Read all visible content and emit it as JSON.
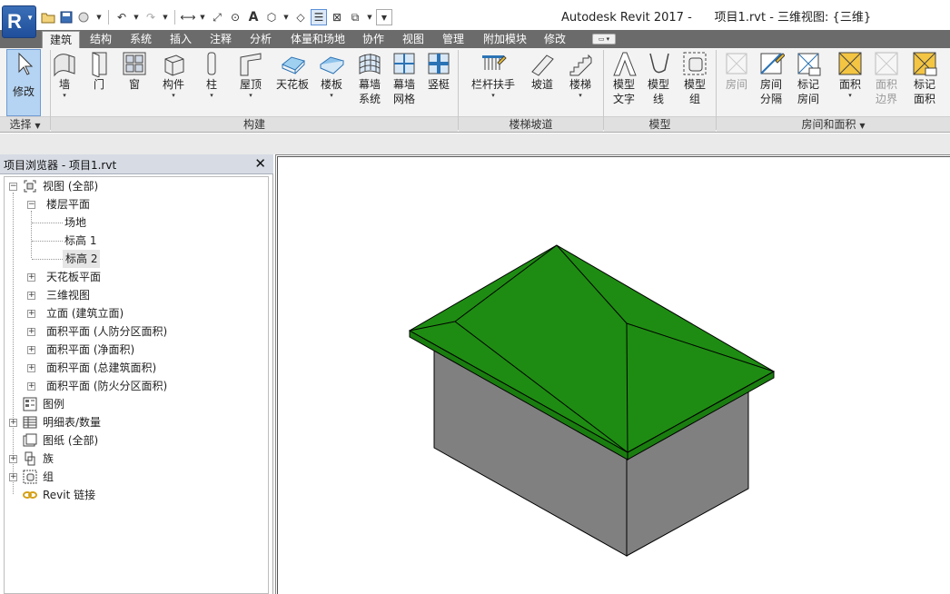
{
  "app": {
    "logo_letter": "R",
    "title_text": "Autodesk Revit 2017 -      项目1.rvt - 三维视图: {三维}"
  },
  "tabs": [
    "建筑",
    "结构",
    "系统",
    "插入",
    "注释",
    "分析",
    "体量和场地",
    "协作",
    "视图",
    "管理",
    "附加模块",
    "修改"
  ],
  "active_tab": "建筑",
  "ribbon": {
    "modify": "修改",
    "wall": "墙",
    "door": "门",
    "window": "窗",
    "component": "构件",
    "column": "柱",
    "roof": "屋顶",
    "ceiling": "天花板",
    "floor": "楼板",
    "curtain_system": [
      "幕墙",
      "系统"
    ],
    "curtain_grid": [
      "幕墙",
      "网格"
    ],
    "mullion": "竖梃",
    "railing": "栏杆扶手",
    "ramp": "坡道",
    "stair": "楼梯",
    "model_text": [
      "模型",
      "文字"
    ],
    "model_line": [
      "模型",
      "线"
    ],
    "model_group": [
      "模型",
      "组"
    ],
    "room": "房间",
    "room_separator": [
      "房间",
      "分隔"
    ],
    "tag_room": [
      "标记",
      "房间"
    ],
    "area": "面积",
    "area_boundary": [
      "面积",
      "边界"
    ],
    "tag_area": [
      "标记",
      "面积"
    ]
  },
  "panels": {
    "select": "选择",
    "build": "构建",
    "circulation": "楼梯坡道",
    "model": "模型",
    "room_area": "房间和面积"
  },
  "browser": {
    "title": "项目浏览器 - 项目1.rvt",
    "close": "✕",
    "nodes": {
      "views": "视图 (全部)",
      "floor_plans": "楼层平面",
      "site": "场地",
      "level1": "标高 1",
      "level2": "标高 2",
      "ceiling_plans": "天花板平面",
      "views_3d": "三维视图",
      "elevations": "立面 (建筑立面)",
      "area_plan_1": "面积平面 (人防分区面积)",
      "area_plan_2": "面积平面 (净面积)",
      "area_plan_3": "面积平面 (总建筑面积)",
      "area_plan_4": "面积平面 (防火分区面积)",
      "legends": "图例",
      "schedules": "明细表/数量",
      "sheets": "图纸 (全部)",
      "families": "族",
      "groups": "组",
      "links": "Revit 链接"
    },
    "selected": "标高 2"
  },
  "model": {
    "roof_color": "#1e8c12",
    "wall_color": "#808080",
    "edge_color": "#000000"
  },
  "accent": "#b5d3f2"
}
